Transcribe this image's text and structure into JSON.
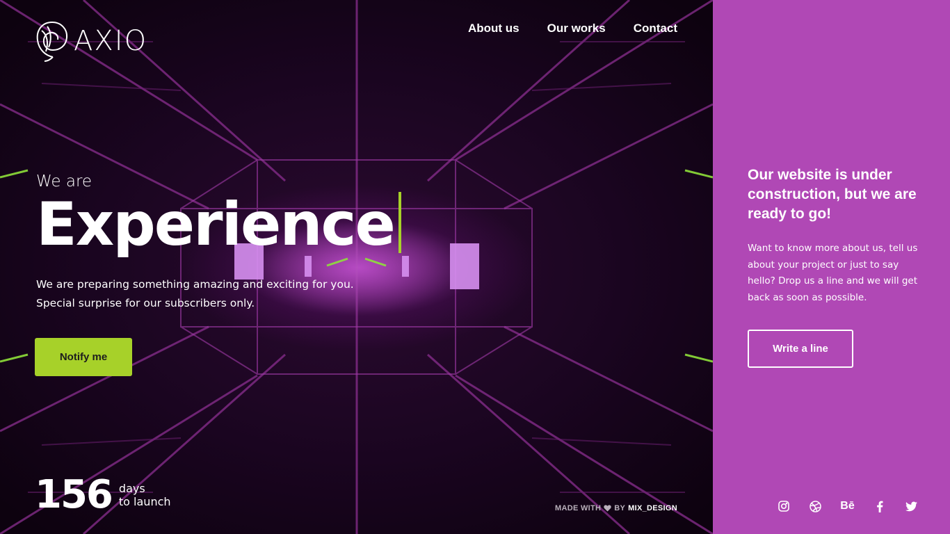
{
  "brand": {
    "logo_text": "AXIO"
  },
  "nav": {
    "items": [
      {
        "label": "About us"
      },
      {
        "label": "Our works"
      },
      {
        "label": "Contact"
      }
    ]
  },
  "hero": {
    "pre_title": "We are",
    "title": "Experience",
    "description_line1": "We are preparing something amazing and exciting for you.",
    "description_line2": "Special surprise for our subscribers only.",
    "cta_label": "Notify me"
  },
  "countdown": {
    "number": "156",
    "unit": "days",
    "suffix": "to launch"
  },
  "footer_credit": {
    "made_with": "MADE WITH",
    "by": "BY",
    "author": "MIX_DESIGN"
  },
  "panel": {
    "title": "Our website is under construction, but we are ready to go!",
    "text": "Want to know more about us, tell us about your project or just to say hello? Drop us a line and we will get back as soon as possible.",
    "cta_label": "Write a line"
  },
  "socials": [
    {
      "icon": "instagram-icon"
    },
    {
      "icon": "dribbble-icon"
    },
    {
      "icon": "behance-icon",
      "text": "Bē"
    },
    {
      "icon": "facebook-icon"
    },
    {
      "icon": "twitter-icon"
    }
  ],
  "colors": {
    "accent_green": "#a7d129",
    "panel_purple": "#b048b5",
    "background_dark": "#14041a"
  }
}
